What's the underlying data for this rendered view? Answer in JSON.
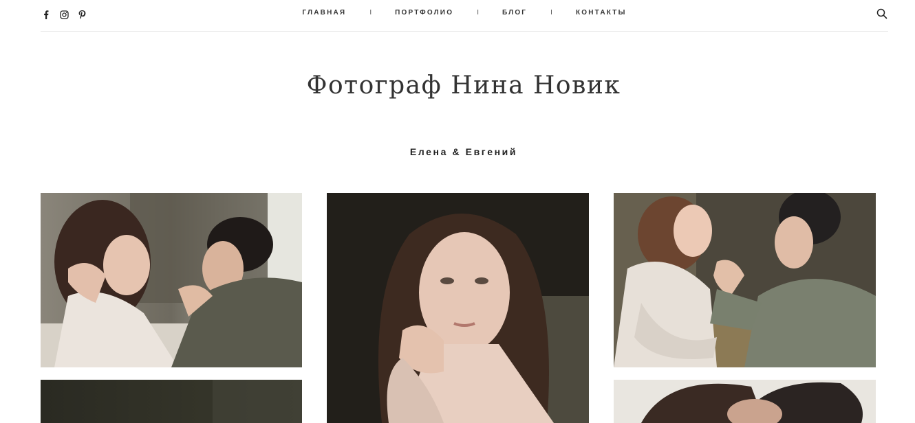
{
  "social": {
    "icons": [
      "facebook-icon",
      "instagram-icon",
      "pinterest-icon"
    ]
  },
  "nav": {
    "items": [
      "ГЛАВНАЯ",
      "ПОРТФОЛИО",
      "БЛОГ",
      "КОНТАКТЫ"
    ],
    "separator": "I"
  },
  "header": {
    "search_icon": "search-icon"
  },
  "site": {
    "title": "Фотограф Нина Новик"
  },
  "gallery": {
    "title": "Елена & Евгений",
    "photos": [
      {
        "id": "couple-hand-kiss"
      },
      {
        "id": "bride-portrait"
      },
      {
        "id": "couple-laughing"
      },
      {
        "id": "dark-photo"
      },
      {
        "id": "couple-close"
      }
    ]
  },
  "colors": {
    "text": "#333333",
    "divider": "#e6e6e6",
    "background": "#ffffff"
  }
}
